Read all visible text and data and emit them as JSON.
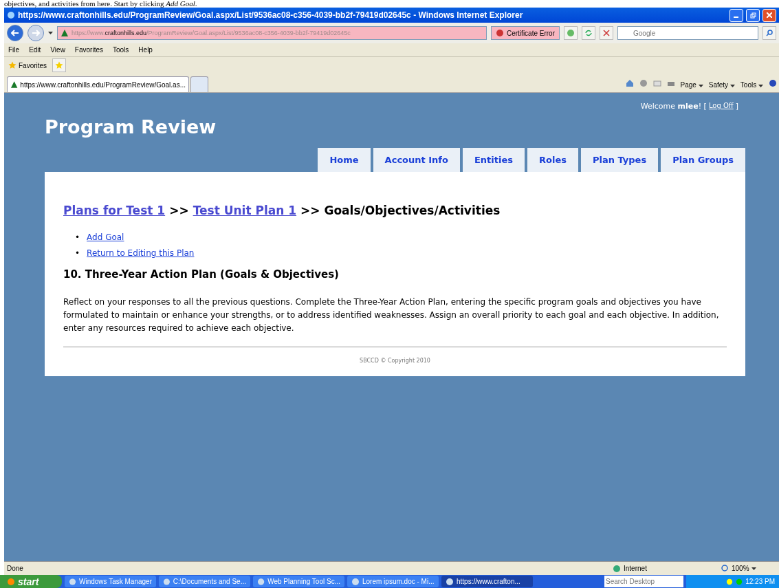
{
  "document_caption": "objectives, and activities from here.  Start by clicking *Add Goal*.",
  "window": {
    "title": "https://www.craftonhills.edu/ProgramReview/Goal.aspx/List/9536ac08-c356-4039-bb2f-79419d02645c - Windows Internet Explorer"
  },
  "address_bar": {
    "url_prefix": "https://www.",
    "url_domain": "craftonhills.edu",
    "url_path": "/ProgramReview/Goal.aspx/List/9536ac08-c356-4039-bb2f-79419d02645c",
    "certificate": "Certificate Error"
  },
  "search": {
    "placeholder": "Google"
  },
  "menu": [
    "File",
    "Edit",
    "View",
    "Favorites",
    "Tools",
    "Help"
  ],
  "favorites_label": "Favorites",
  "tabs": [
    {
      "label": "https://www.craftonhills.edu/ProgramReview/Goal.as...",
      "selected": true
    }
  ],
  "command_bar": [
    "Page",
    "Safety",
    "Tools"
  ],
  "page": {
    "welcome": "Welcome **mlee**! [",
    "logoff": "Log Off",
    "welcome_end": "]",
    "site_title": "Program Review",
    "nav": [
      {
        "label": "Home"
      },
      {
        "label": "Account Info"
      },
      {
        "label": "Entities"
      },
      {
        "label": "Roles"
      },
      {
        "label": "Plan Types"
      },
      {
        "label": "Plan Groups"
      }
    ],
    "breadcrumb": [
      {
        "kind": "link",
        "text": "Plans for Test 1"
      },
      {
        "kind": "text",
        "text": ">>"
      },
      {
        "kind": "link",
        "text": "Test Unit Plan 1"
      },
      {
        "kind": "text",
        "text": ">> Goals/Objectives/Activities"
      }
    ],
    "actions": [
      {
        "marker": "•",
        "label": "Add Goal"
      },
      {
        "marker": "•",
        "label": "Return to Editing this Plan"
      }
    ],
    "section_title": "10. Three-Year Action Plan (Goals & Objectives)",
    "instructions": "Reflect on your responses to all the previous questions. Complete the Three-Year Action Plan, entering the specific program goals and objectives you have formulated to maintain or enhance your strengths, or to address identified weaknesses. Assign an overall priority to each goal and each objective. In addition, enter any resources required to achieve each objective.",
    "footer": "SBCCD © Copyright 2010"
  },
  "status_bar": {
    "text": "Done",
    "zone": "Internet",
    "zoom": "100%"
  },
  "taskbar": {
    "start": "start",
    "items": [
      {
        "label": "Windows Task Manager",
        "selected": false
      },
      {
        "label": "C:\\Documents and Se...",
        "selected": false
      },
      {
        "label": "Web Planning Tool Sc...",
        "selected": false
      },
      {
        "label": "Lorem ipsum.doc - Mi...",
        "selected": false
      },
      {
        "label": "https://www.crafton...",
        "selected": true
      }
    ],
    "search_placeholder": "Search Desktop",
    "clock": "12:23 PM"
  }
}
